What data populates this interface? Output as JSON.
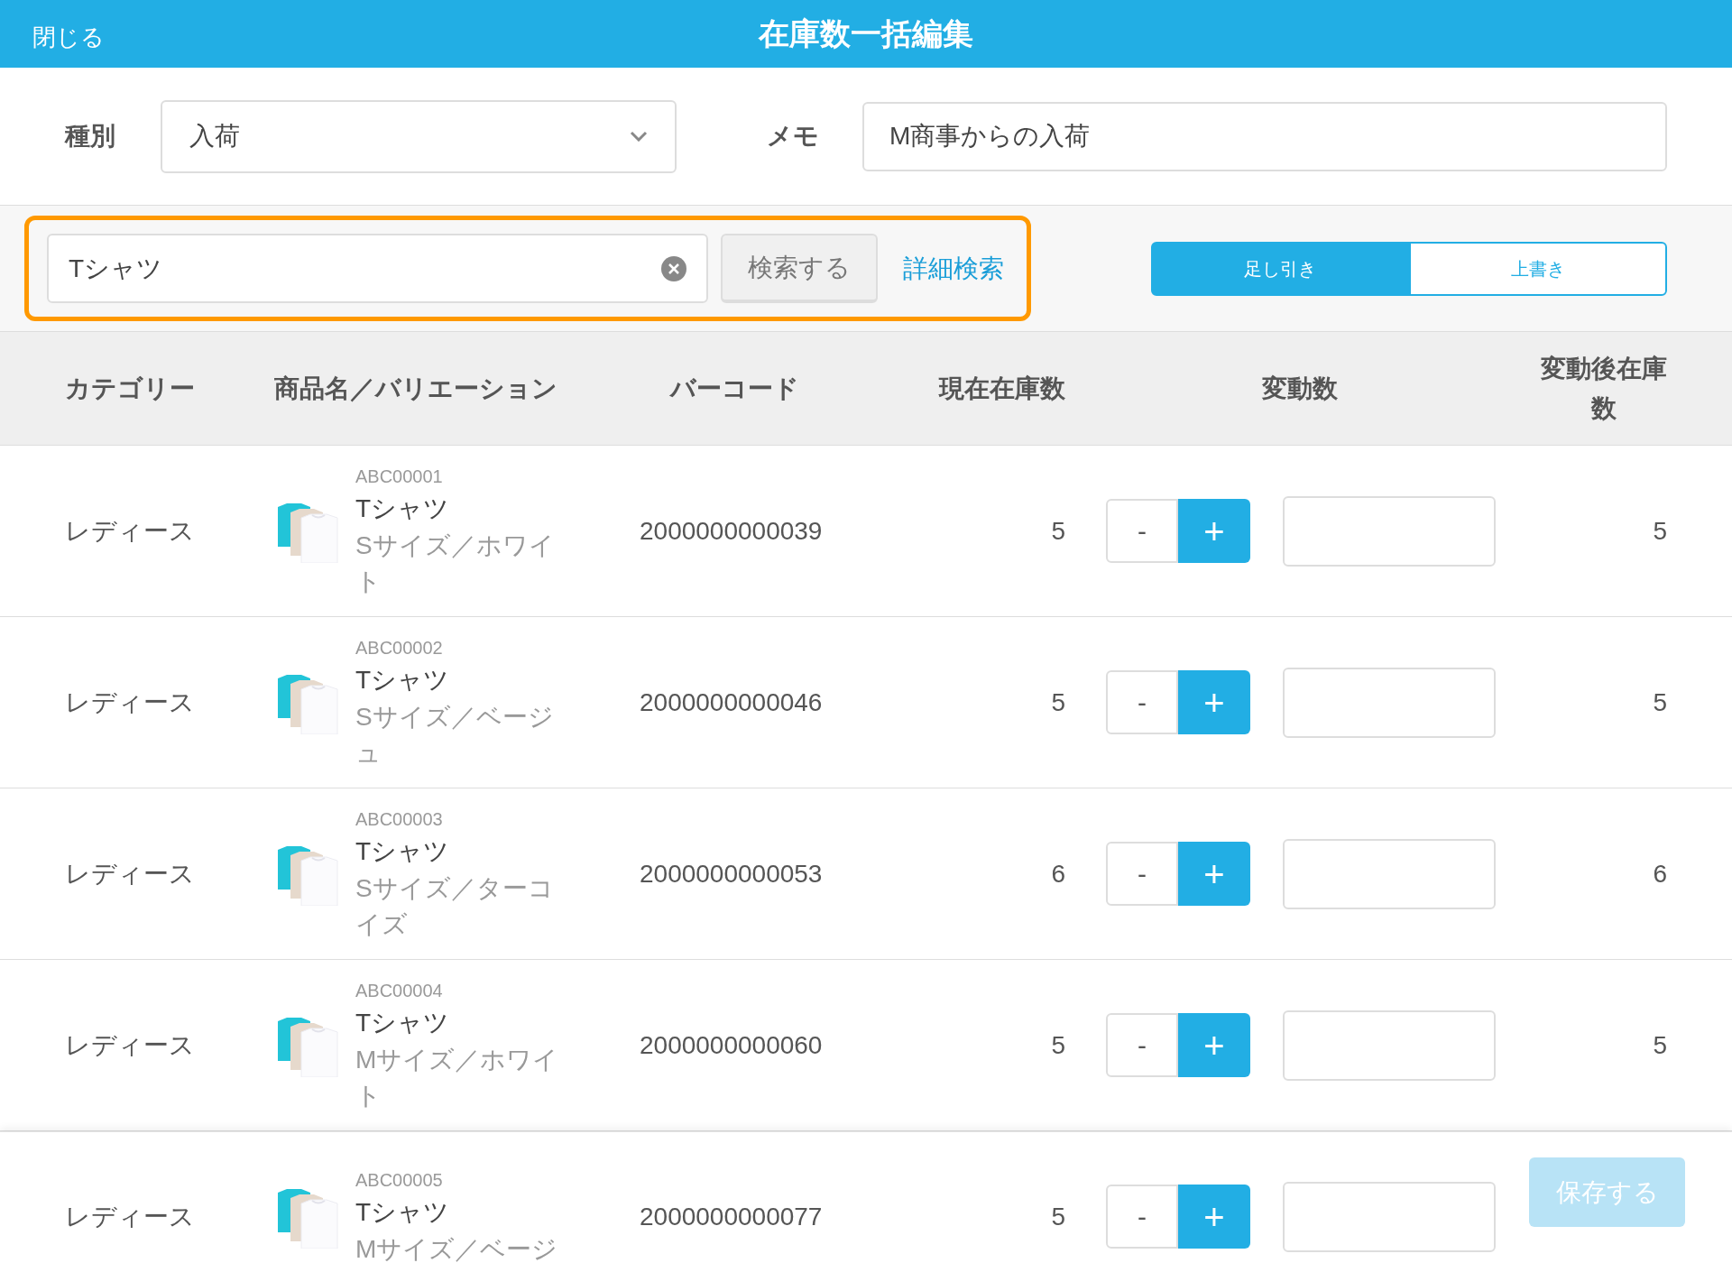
{
  "header": {
    "close": "閉じる",
    "title": "在庫数一括編集"
  },
  "filters": {
    "type_label": "種別",
    "type_value": "入荷",
    "memo_label": "メモ",
    "memo_value": "M商事からの入荷"
  },
  "search": {
    "value": "Tシャツ",
    "button": "検索する",
    "advanced_link": "詳細検索",
    "highlighted": true
  },
  "mode_tabs": [
    {
      "label": "足し引き",
      "selected": true
    },
    {
      "label": "上書き",
      "selected": false
    }
  ],
  "table": {
    "columns": [
      "カテゴリー",
      "商品名／バリエーション",
      "バーコード",
      "現在在庫数",
      "変動数",
      "変動後在庫数"
    ],
    "rows": [
      {
        "category": "レディース",
        "code": "ABC00001",
        "name": "Tシャツ",
        "variant": "Sサイズ／ホワイト",
        "barcode": "2000000000039",
        "current": "5",
        "minus": "-",
        "plus": "+",
        "after": "5"
      },
      {
        "category": "レディース",
        "code": "ABC00002",
        "name": "Tシャツ",
        "variant": "Sサイズ／ベージュ",
        "barcode": "2000000000046",
        "current": "5",
        "minus": "-",
        "plus": "+",
        "after": "5"
      },
      {
        "category": "レディース",
        "code": "ABC00003",
        "name": "Tシャツ",
        "variant": "Sサイズ／ターコイズ",
        "barcode": "2000000000053",
        "current": "6",
        "minus": "-",
        "plus": "+",
        "after": "6"
      },
      {
        "category": "レディース",
        "code": "ABC00004",
        "name": "Tシャツ",
        "variant": "Mサイズ／ホワイト",
        "barcode": "2000000000060",
        "current": "5",
        "minus": "-",
        "plus": "+",
        "after": "5"
      },
      {
        "category": "レディース",
        "code": "ABC00005",
        "name": "Tシャツ",
        "variant": "Mサイズ／ベージ",
        "barcode": "2000000000077",
        "current": "5",
        "minus": "-",
        "plus": "+"
      }
    ]
  },
  "footer": {
    "save_button": "保存する",
    "disabled": true
  }
}
